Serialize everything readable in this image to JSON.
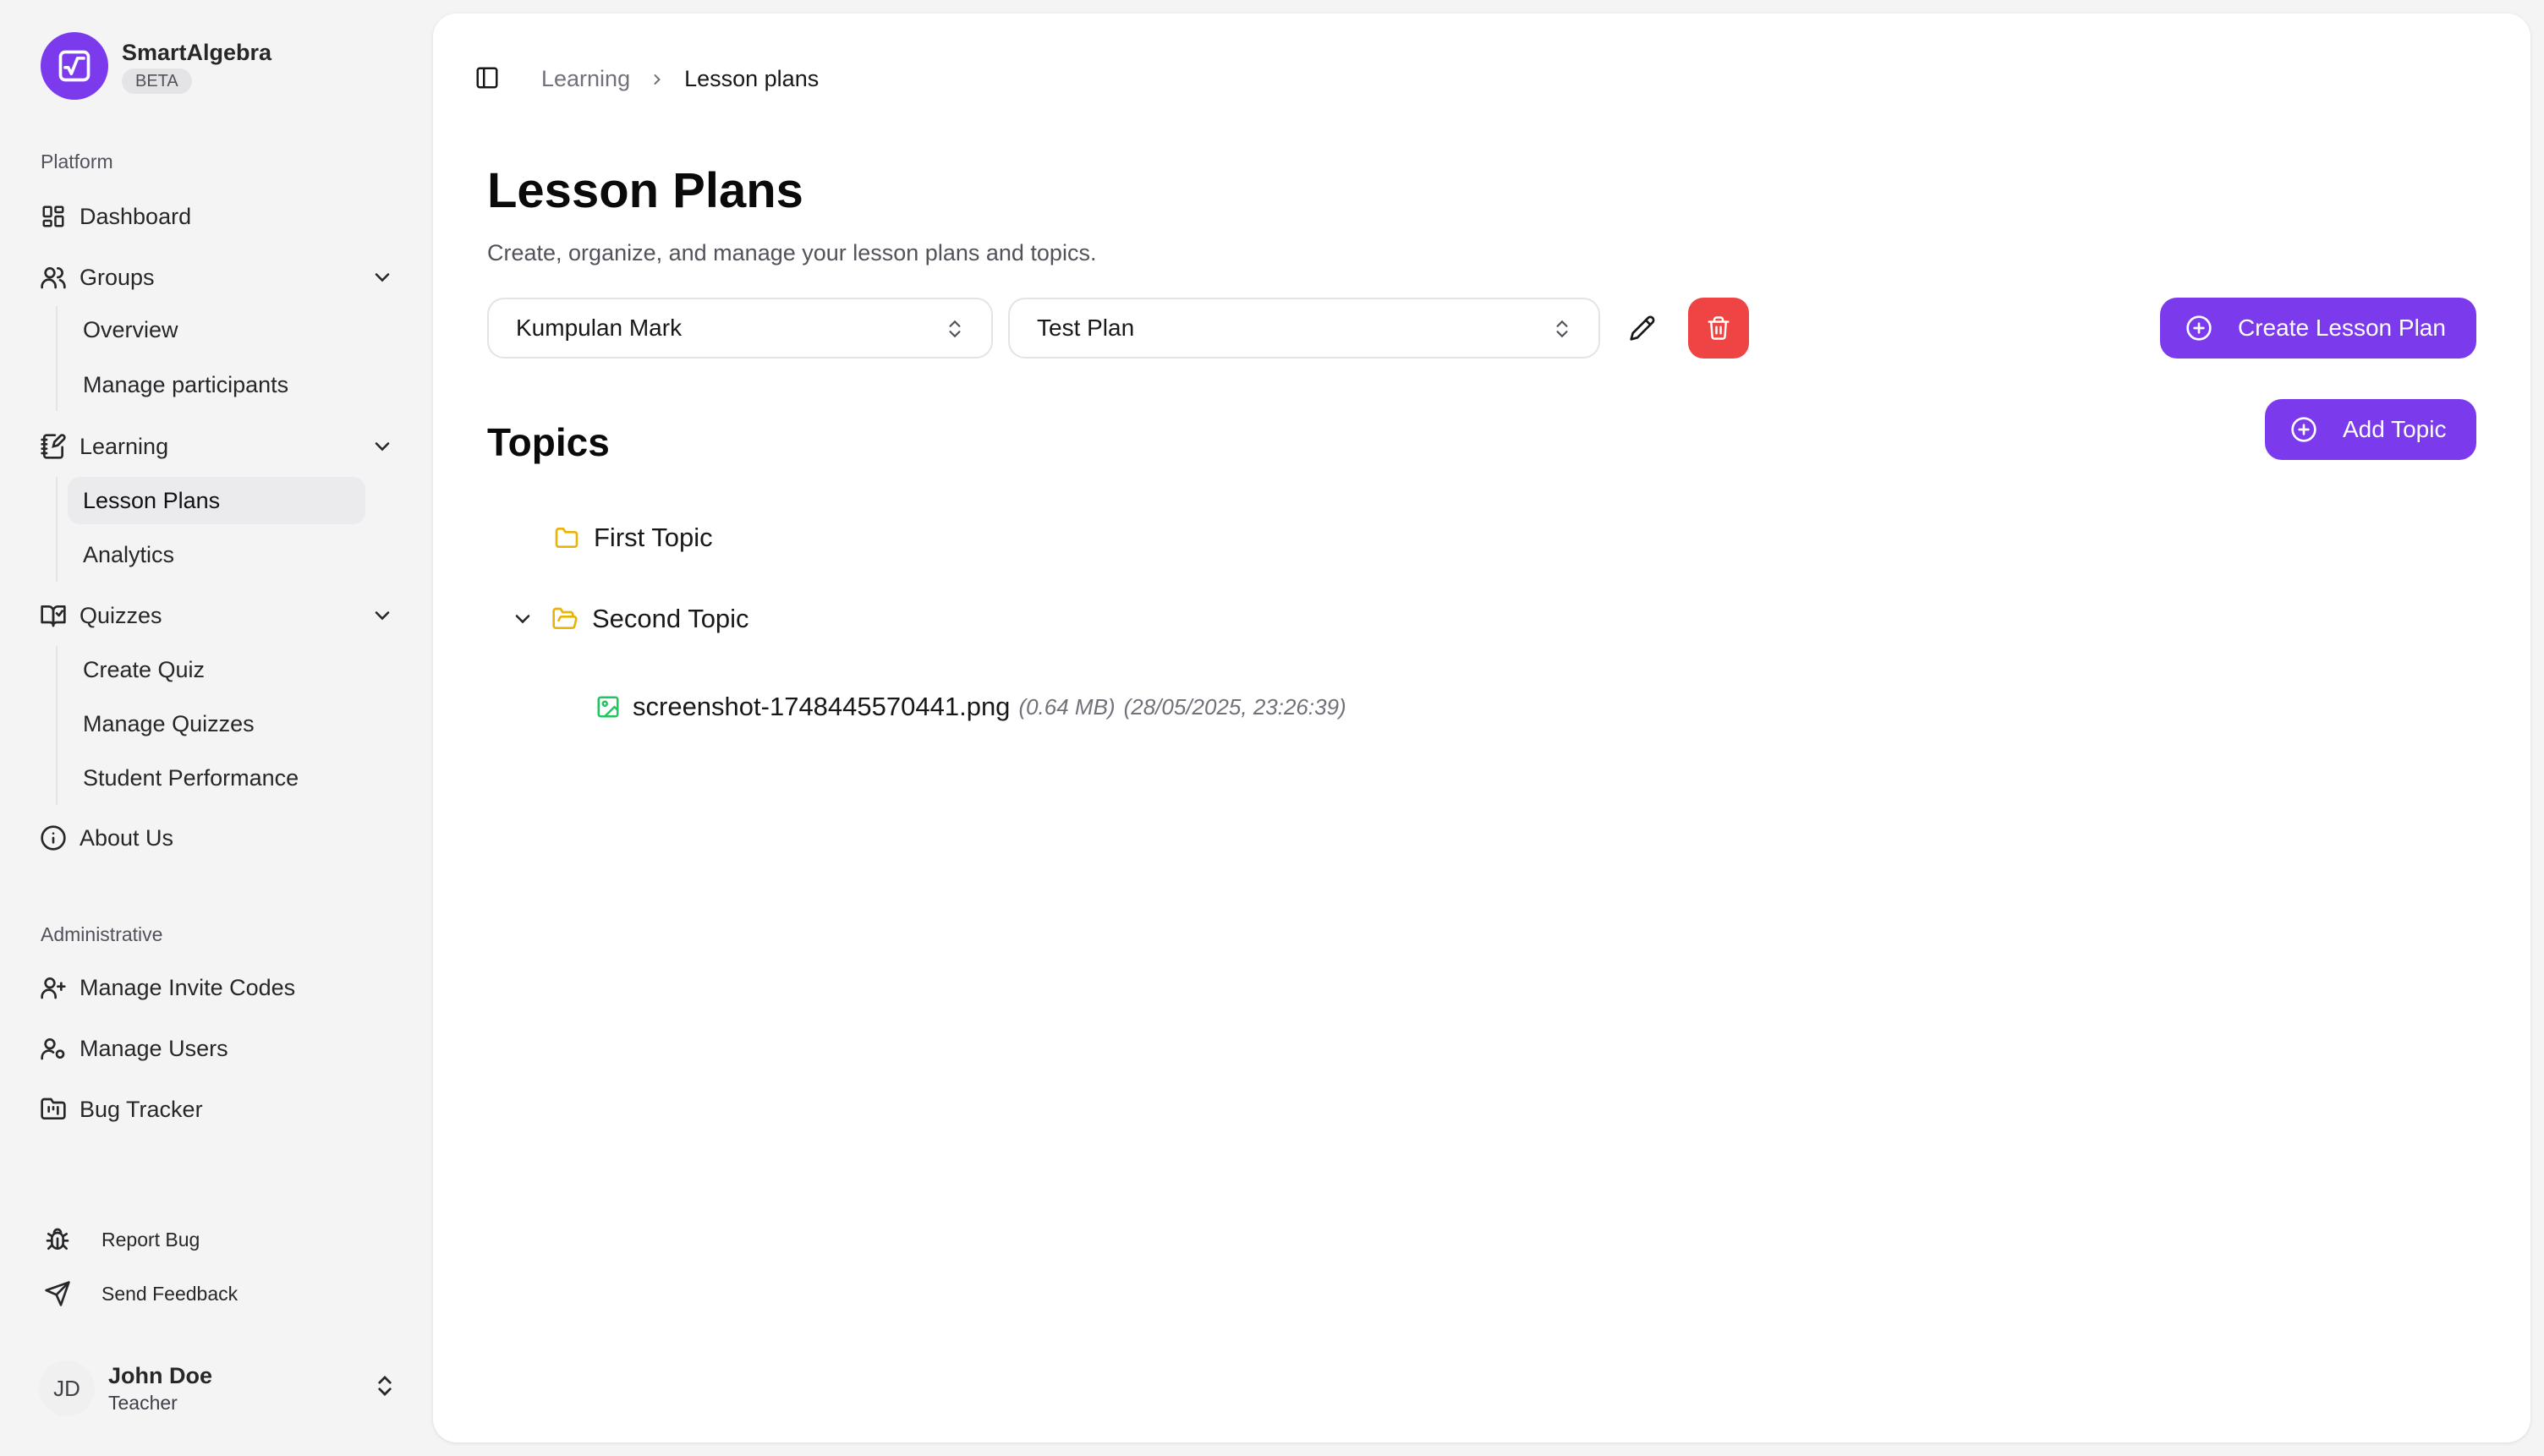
{
  "brand": {
    "name": "SmartAlgebra",
    "badge": "BETA"
  },
  "sidebar": {
    "platform_label": "Platform",
    "dashboard": "Dashboard",
    "groups": {
      "label": "Groups",
      "items": [
        "Overview",
        "Manage participants"
      ]
    },
    "learning": {
      "label": "Learning",
      "items": [
        "Lesson Plans",
        "Analytics"
      ],
      "active": "Lesson Plans"
    },
    "quizzes": {
      "label": "Quizzes",
      "items": [
        "Create Quiz",
        "Manage Quizzes",
        "Student Performance"
      ]
    },
    "about": "About Us",
    "admin_label": "Administrative",
    "admin_items": [
      "Manage Invite Codes",
      "Manage Users",
      "Bug Tracker"
    ],
    "footer_items": [
      "Report Bug",
      "Send Feedback"
    ]
  },
  "user": {
    "initials": "JD",
    "name": "John Doe",
    "role": "Teacher"
  },
  "breadcrumb": {
    "parent": "Learning",
    "current": "Lesson plans"
  },
  "page": {
    "title": "Lesson Plans",
    "subtitle": "Create, organize, and manage your lesson plans and topics."
  },
  "controls": {
    "group_select": "Kumpulan Mark",
    "plan_select": "Test Plan",
    "create_button": "Create Lesson Plan"
  },
  "topics": {
    "title": "Topics",
    "add_button": "Add Topic",
    "items": [
      {
        "name": "First Topic",
        "expanded": false
      },
      {
        "name": "Second Topic",
        "expanded": true
      }
    ],
    "file": {
      "name": "screenshot-1748445570441.png",
      "size": "(0.64 MB)",
      "date": "(28/05/2025, 23:26:39)"
    }
  },
  "colors": {
    "accent": "#7c3aed",
    "danger": "#ef4444",
    "folder": "#eab308",
    "file_icon": "#22c55e"
  }
}
